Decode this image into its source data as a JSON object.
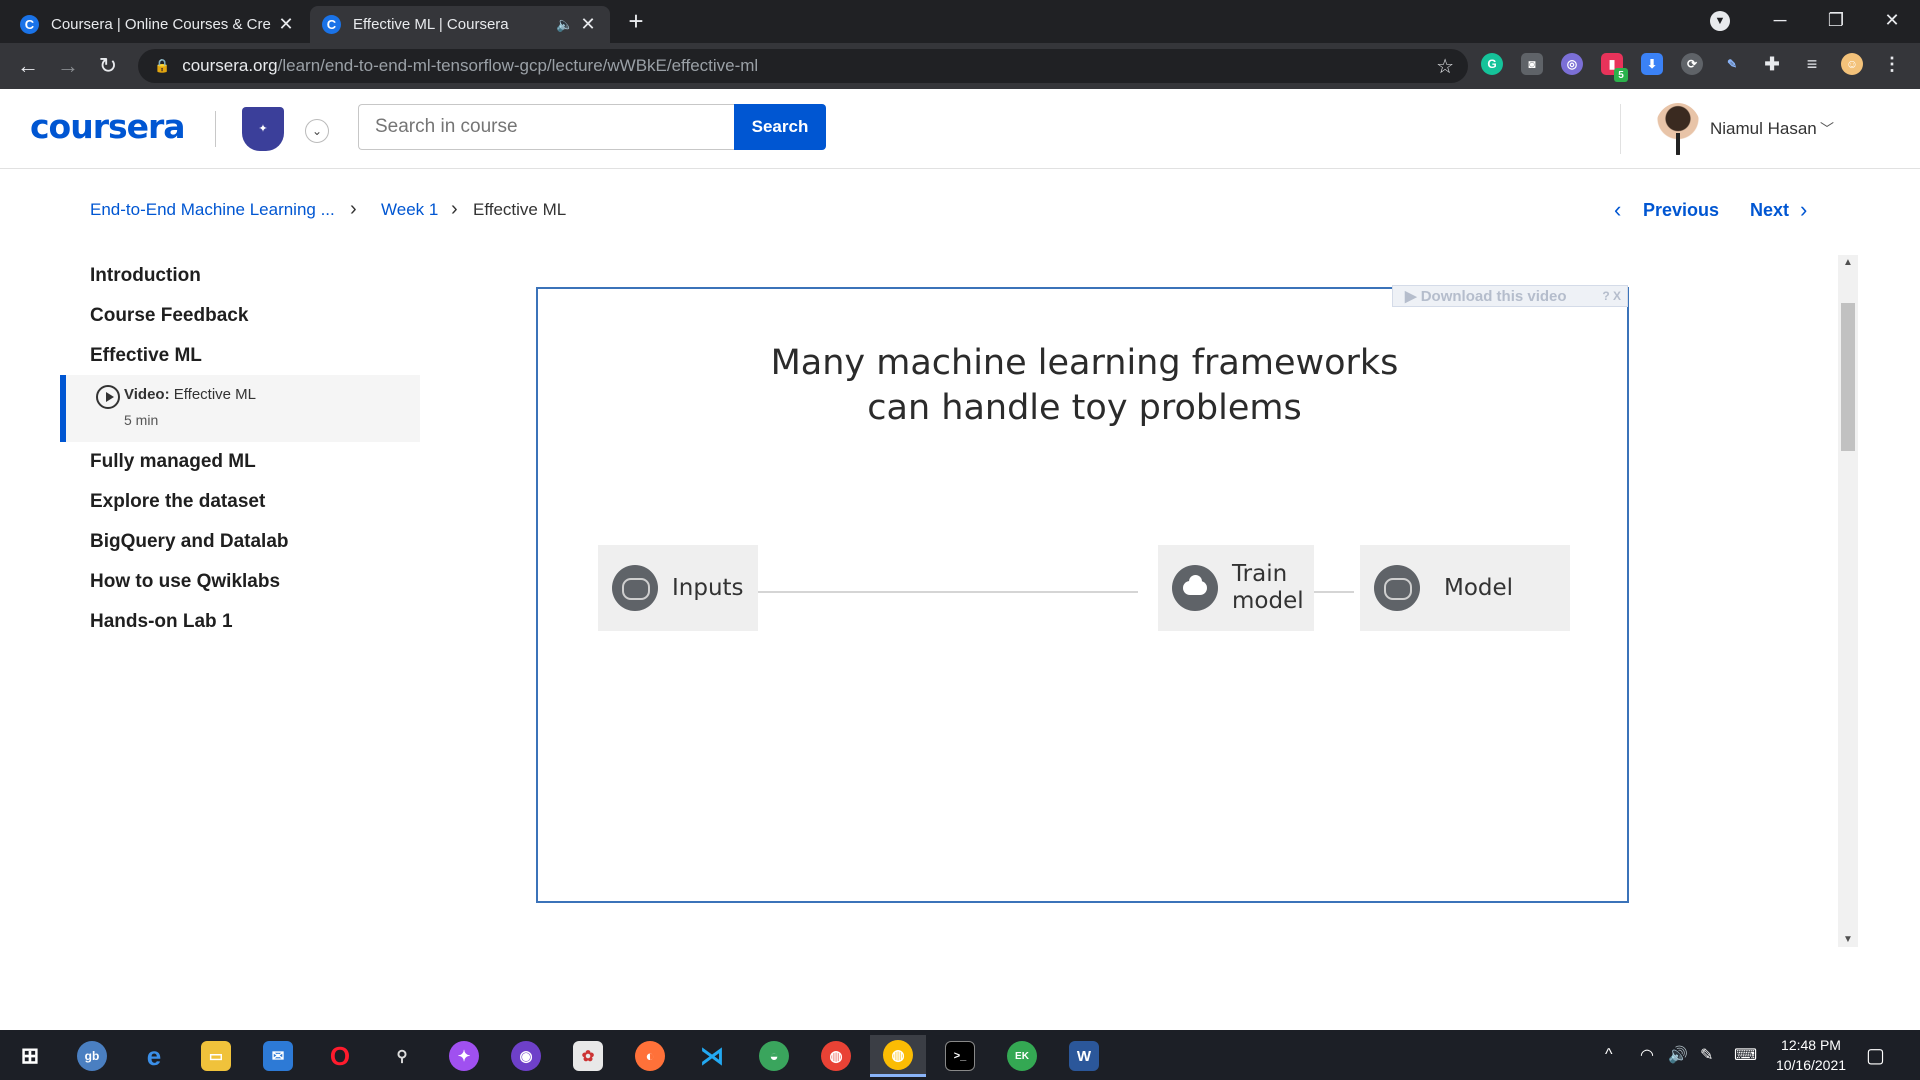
{
  "browser": {
    "tabs": [
      {
        "title": "Coursera | Online Courses & Cre",
        "favicon": "C"
      },
      {
        "title": "Effective ML | Coursera",
        "favicon": "C"
      }
    ],
    "url_host": "coursera.org",
    "url_path": "/learn/end-to-end-ml-tensorflow-gcp/lecture/wWBkE/effective-ml",
    "extension_badge": "5"
  },
  "header": {
    "logo": "coursera",
    "search_placeholder": "Search in course",
    "search_button": "Search",
    "user_name": "Niamul Hasan"
  },
  "breadcrumb": {
    "course": "End-to-End Machine Learning ...",
    "week": "Week 1",
    "current": "Effective ML"
  },
  "nav": {
    "previous": "Previous",
    "next": "Next"
  },
  "sidebar": {
    "items": [
      "Introduction",
      "Course Feedback",
      "Effective ML",
      "Fully managed ML",
      "Explore the dataset",
      "BigQuery and Datalab",
      "How to use Qwiklabs",
      "Hands-on Lab 1"
    ],
    "active_sub": {
      "type_label": "Video:",
      "title": "Effective ML",
      "duration": "5 min"
    }
  },
  "video": {
    "download_label": "▶ Download this video",
    "download_tools": "? X",
    "slide_title_line1": "Many machine learning frameworks",
    "slide_title_line2": "can handle toy problems",
    "diagram": {
      "inputs": "Inputs",
      "train_line1": "Train",
      "train_line2": "model",
      "model": "Model"
    }
  },
  "taskbar": {
    "time": "12:48 PM",
    "date": "10/16/2021"
  },
  "colors": {
    "brand": "#0056d2",
    "tab_bg": "#202124",
    "taskbar_bg": "#1c1f26"
  }
}
